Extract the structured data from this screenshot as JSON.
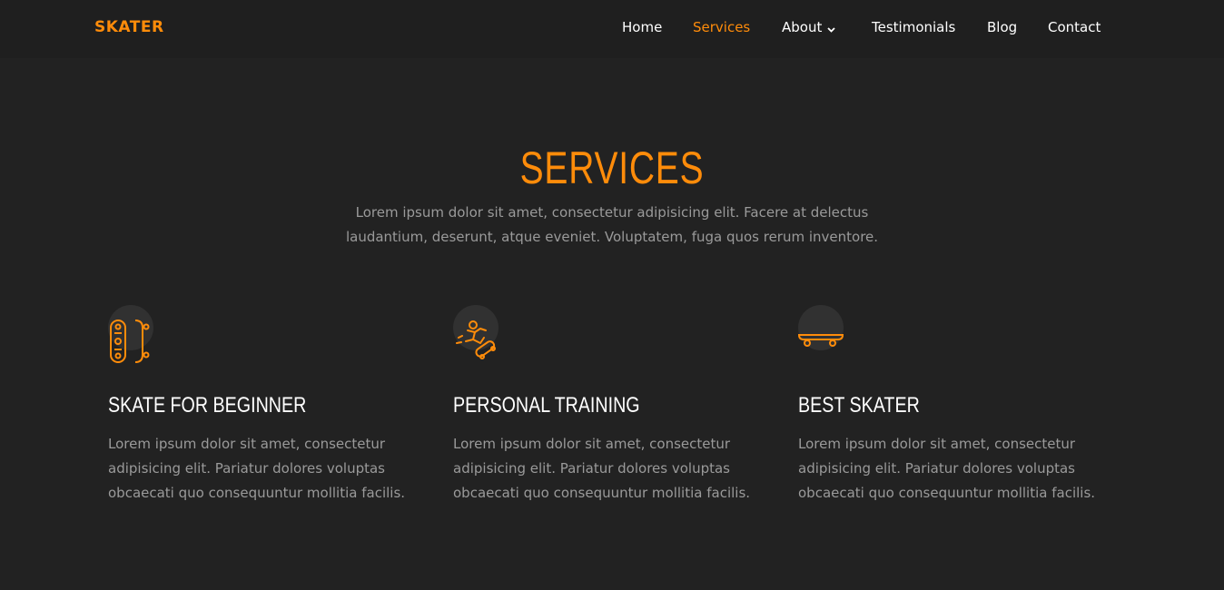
{
  "brand": "SKATER",
  "nav": {
    "home": "Home",
    "services": "Services",
    "about": "About",
    "testimonials": "Testimonials",
    "blog": "Blog",
    "contact": "Contact"
  },
  "colors": {
    "accent": "#ff8c0a",
    "background": "#222222",
    "text_muted": "#9a9a9a"
  },
  "services": {
    "title": "SERVICES",
    "description": "Lorem ipsum dolor sit amet, consectetur adipisicing elit. Facere at delectus laudantium, deserunt, atque eveniet. Voluptatem, fuga quos rerum inventore.",
    "items": [
      {
        "icon": "skateboard-pair-icon",
        "title": "SKATE FOR BEGINNER",
        "text": "Lorem ipsum dolor sit amet, consectetur adipisicing elit. Pariatur dolores voluptas obcaecati quo consequuntur mollitia facilis."
      },
      {
        "icon": "skater-jumping-icon",
        "title": "PERSONAL TRAINING",
        "text": "Lorem ipsum dolor sit amet, consectetur adipisicing elit. Pariatur dolores voluptas obcaecati quo consequuntur mollitia facilis."
      },
      {
        "icon": "skateboard-side-icon",
        "title": "BEST SKATER",
        "text": "Lorem ipsum dolor sit amet, consectetur adipisicing elit. Pariatur dolores voluptas obcaecati quo consequuntur mollitia facilis."
      }
    ]
  }
}
